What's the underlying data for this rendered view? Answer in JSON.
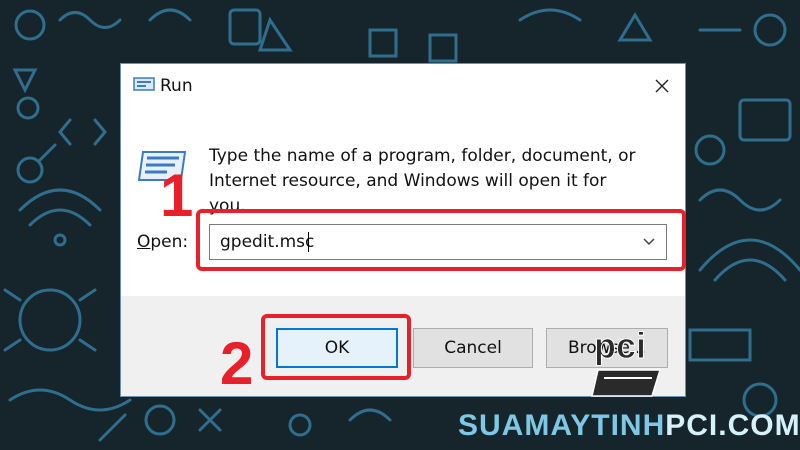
{
  "dialog": {
    "title": "Run",
    "description": "Type the name of a program, folder, document, or Internet resource, and Windows will open it for you.",
    "open_label_mnemonic": "O",
    "open_label_rest": "pen:",
    "input_value": "gpedit.msc",
    "buttons": {
      "ok": "OK",
      "cancel": "Cancel",
      "browse": "Browse..."
    },
    "icons": {
      "title": "run-app-icon",
      "close": "close-icon",
      "dropdown": "chevron-down-icon",
      "program": "run-program-icon"
    }
  },
  "annotations": {
    "step1": "1",
    "step2": "2",
    "highlight_color": "#e8202a"
  },
  "watermark": {
    "logo_text": "pci",
    "site_part1": "SUAMAYTINH",
    "site_part2": "PCI.COM"
  },
  "colors": {
    "background": "#16242c",
    "doodle": "#2f6e8c",
    "accent": "#0078d7"
  }
}
